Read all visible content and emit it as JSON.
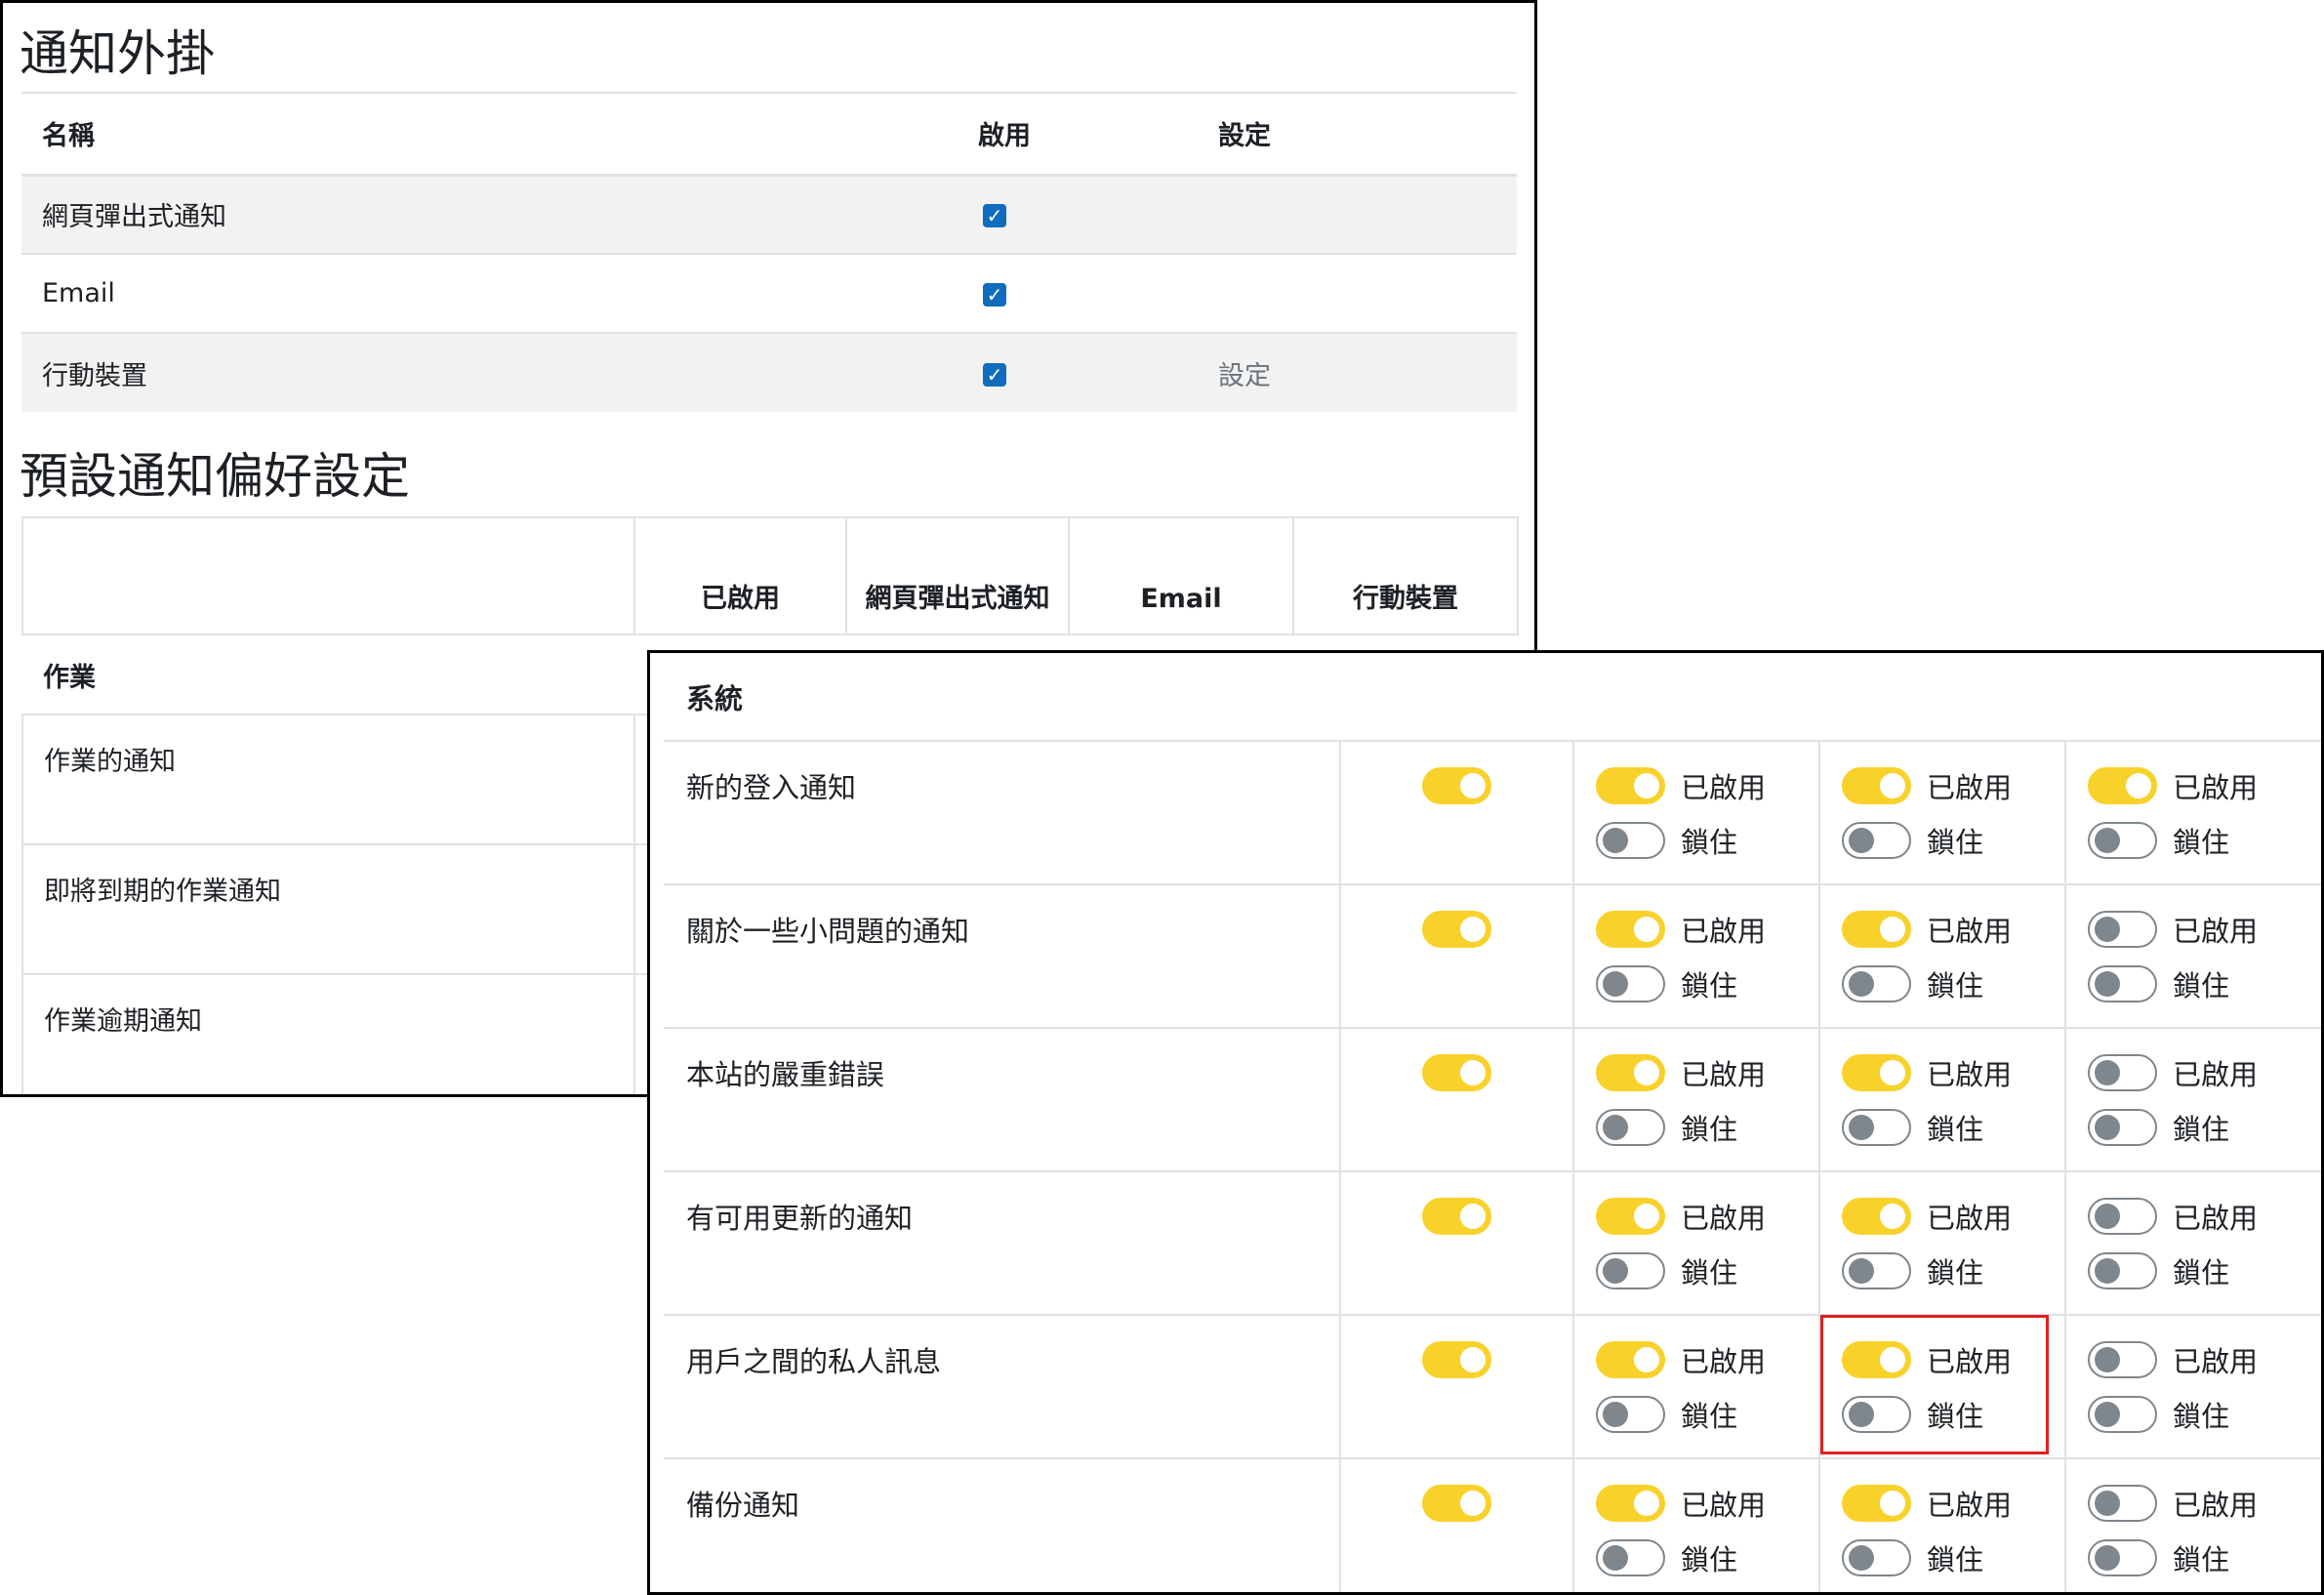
{
  "plugins": {
    "title": "通知外掛",
    "headers": {
      "name": "名稱",
      "enable": "啟用",
      "settings": "設定"
    },
    "rows": [
      {
        "name": "網頁彈出式通知",
        "enabled": true,
        "settings": ""
      },
      {
        "name": "Email",
        "enabled": true,
        "settings": ""
      },
      {
        "name": "行動裝置",
        "enabled": true,
        "settings": "設定"
      }
    ]
  },
  "preferences": {
    "title": "預設通知偏好設定",
    "headers": {
      "enabled": "已啟用",
      "popup": "網頁彈出式通知",
      "email": "Email",
      "mobile": "行動裝置"
    },
    "assignment": {
      "group": "作業",
      "items": [
        "作業的通知",
        "即將到期的作業通知",
        "作業逾期通知"
      ]
    },
    "system": {
      "group": "系統",
      "enabled_label": "已啟用",
      "locked_label": "鎖住",
      "items": [
        {
          "name": "新的登入通知",
          "enabled": true,
          "popup": [
            true,
            false
          ],
          "email": [
            true,
            false
          ],
          "mobile": [
            true,
            false
          ]
        },
        {
          "name": "關於一些小問題的通知",
          "enabled": true,
          "popup": [
            true,
            false
          ],
          "email": [
            true,
            false
          ],
          "mobile": [
            false,
            false
          ]
        },
        {
          "name": "本站的嚴重錯誤",
          "enabled": true,
          "popup": [
            true,
            false
          ],
          "email": [
            true,
            false
          ],
          "mobile": [
            false,
            false
          ]
        },
        {
          "name": "有可用更新的通知",
          "enabled": true,
          "popup": [
            true,
            false
          ],
          "email": [
            true,
            false
          ],
          "mobile": [
            false,
            false
          ]
        },
        {
          "name": "用戶之間的私人訊息",
          "enabled": true,
          "popup": [
            true,
            false
          ],
          "email": [
            true,
            false
          ],
          "mobile": [
            false,
            false
          ]
        },
        {
          "name": "備份通知",
          "enabled": true,
          "popup": [
            true,
            false
          ],
          "email": [
            true,
            false
          ],
          "mobile": [
            false,
            false
          ]
        }
      ]
    }
  },
  "colors": {
    "toggle_on": "#f8d22b",
    "toggle_off": "#7f868c",
    "checkbox": "#0f6cbf",
    "highlight": "#e02020"
  }
}
